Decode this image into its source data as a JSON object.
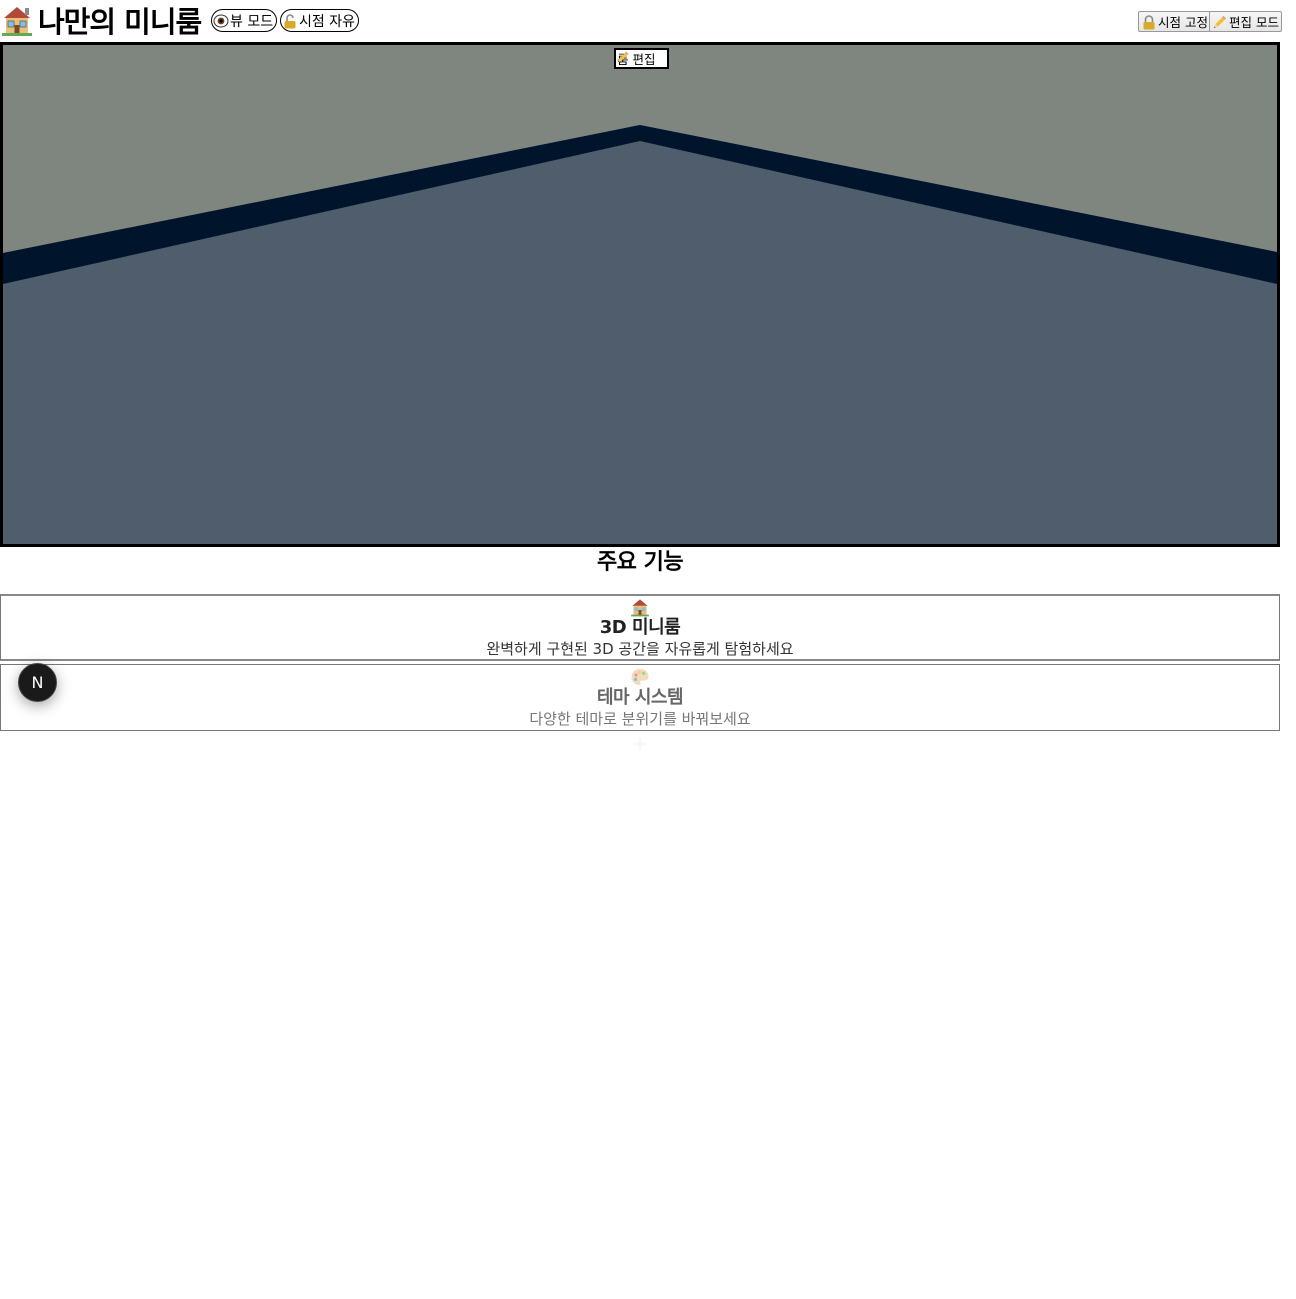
{
  "header": {
    "title": "나만의 미니룸",
    "view_mode_label": "뷰 모드",
    "camera_free_label": "시점 자유",
    "camera_lock_label": "시점 고정",
    "edit_mode_label": "편집 모드"
  },
  "scene": {
    "room_edit_label": "룸 편집",
    "colors": {
      "wall": "#7f8680",
      "trim": "#00152b",
      "floor": "#4f5d6d"
    }
  },
  "features": {
    "title": "주요 기능",
    "items": [
      {
        "icon": "house-icon",
        "title": "3D 미니룸",
        "description": "완벽하게 구현된 3D 공간을 자유롭게 탐험하세요"
      },
      {
        "icon": "palette-icon",
        "title": "테마 시스템",
        "description": "다양한 테마로 분위기를 바꿔보세요"
      }
    ]
  },
  "fab": {
    "label": "N"
  }
}
